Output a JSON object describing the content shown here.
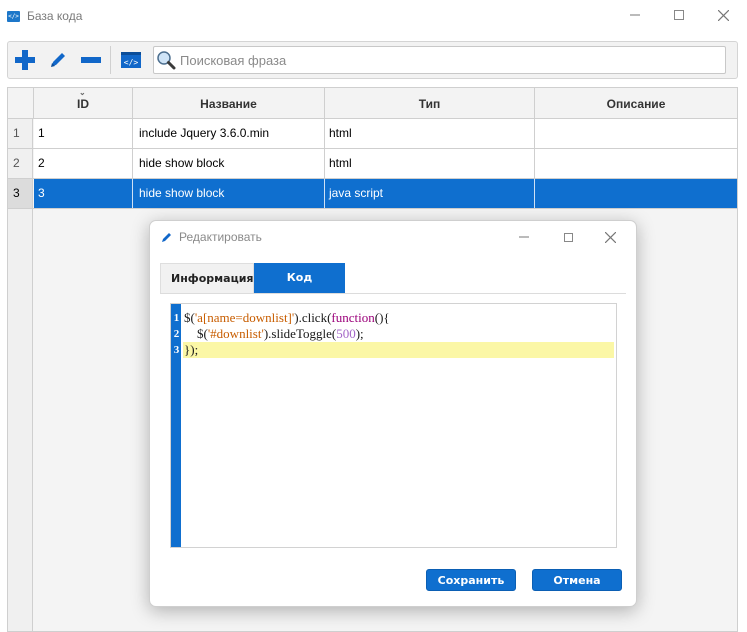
{
  "window": {
    "title": "База кода",
    "icon_text": "</>"
  },
  "toolbar": {
    "search_placeholder": "Поисковая фраза",
    "icons": [
      "add-icon",
      "edit-icon",
      "remove-icon",
      "code-file-icon",
      "search-icon"
    ]
  },
  "table": {
    "columns": [
      "ID",
      "Название",
      "Тип",
      "Описание"
    ],
    "rows": [
      {
        "num": "1",
        "id": "1",
        "name": "include Jquery 3.6.0.min",
        "type": "html",
        "desc": ""
      },
      {
        "num": "2",
        "id": "2",
        "name": "hide show block",
        "type": "html",
        "desc": ""
      },
      {
        "num": "3",
        "id": "3",
        "name": "hide show block",
        "type": "java script",
        "desc": ""
      }
    ],
    "selected_row": 3
  },
  "dialog": {
    "title": "Редактировать",
    "tabs": [
      "Информация",
      "Код"
    ],
    "active_tab": "Код",
    "code_lines": [
      {
        "num": "1",
        "text": "$('a[name=downlist]').click(function(){"
      },
      {
        "num": "2",
        "text": "    $('#downlist').slideToggle(500);"
      },
      {
        "num": "3",
        "text": "});"
      }
    ],
    "active_line": 3,
    "save_label": "Сохранить",
    "cancel_label": "Отмена"
  },
  "colors": {
    "accent": "#0f6fcf",
    "active_line": "#fbf7a6",
    "string": "#c85d00",
    "keyword": "#9b007a",
    "number": "#a467c8"
  }
}
